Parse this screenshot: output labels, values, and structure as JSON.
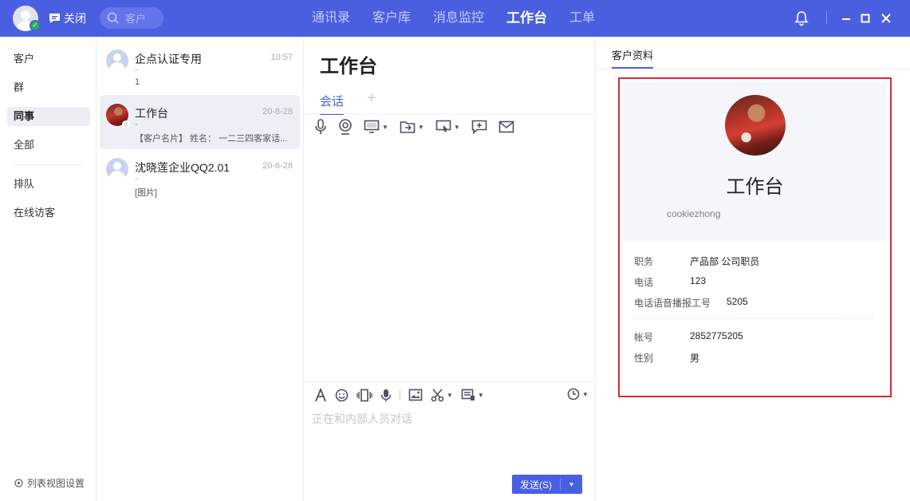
{
  "topbar": {
    "close_label": "关闭",
    "search_placeholder": "客户",
    "nav": [
      "通讯录",
      "客户库",
      "消息监控",
      "工作台",
      "工单"
    ],
    "active_nav": "工作台",
    "icons": [
      "bell-icon",
      "minimize-icon",
      "maximize-icon",
      "close-window-icon"
    ],
    "accent_color": "#4a5fe0"
  },
  "sidebar": {
    "items": [
      {
        "label": "客户"
      },
      {
        "label": "群"
      },
      {
        "label": "同事"
      },
      {
        "label": "全部"
      },
      {
        "label": "排队"
      },
      {
        "label": "在线访客"
      }
    ],
    "active": "同事",
    "settings_label": "列表视图设置"
  },
  "conversations": [
    {
      "name": "企点认证专用",
      "time": "10:57",
      "sub": "-",
      "last": "1"
    },
    {
      "name": "工作台",
      "time": "20-8-28",
      "sub": "-",
      "last": "【客户名片】 姓名： 一二三四客家话..."
    },
    {
      "name": "沈晓莲企业QQ2.01",
      "time": "20-6-28",
      "sub": "-",
      "last": "[图片]"
    }
  ],
  "chat": {
    "title": "工作台",
    "tab": "会话",
    "add_tab": "+",
    "input_placeholder": "正在和内部人员对话",
    "send_label": "发送(S)"
  },
  "profile": {
    "tab": "客户资料",
    "name": "工作台",
    "account_id": "cookiezhong",
    "fields": [
      {
        "label": "职务",
        "value": "产品部 公司职员"
      },
      {
        "label": "电话",
        "value": "123"
      },
      {
        "label": "电话语音播报工号",
        "value": "5205"
      },
      {
        "label": "帐号",
        "value": "2852775205"
      },
      {
        "label": "性别",
        "value": "男"
      }
    ],
    "highlight_color": "#e0282e"
  }
}
